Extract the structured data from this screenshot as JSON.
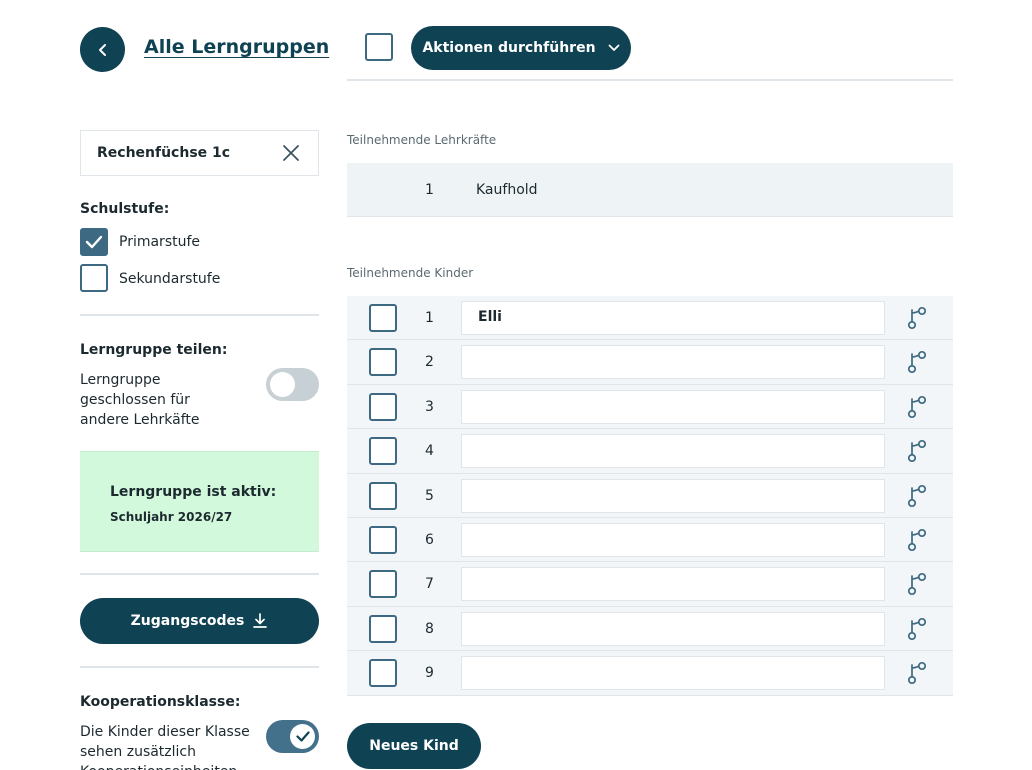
{
  "header": {
    "back_label": "Alle Lerngruppen",
    "actions_label": "Aktionen durchführen"
  },
  "group": {
    "name": "Rechenfüchse 1c"
  },
  "schulstufe": {
    "label": "Schulstufe:",
    "options": [
      {
        "label": "Primarstufe",
        "checked": true
      },
      {
        "label": "Sekundarstufe",
        "checked": false
      }
    ]
  },
  "sharing": {
    "label": "Lerngruppe teilen:",
    "description": "Lerngruppe geschlossen für andere Lehrkäfte",
    "enabled": false
  },
  "status": {
    "title": "Lerngruppe ist aktiv:",
    "year": "Schuljahr 2026/27"
  },
  "access_codes": {
    "label": "Zugangscodes"
  },
  "cooperation": {
    "label": "Kooperationsklasse:",
    "description": "Die Kinder dieser Klasse sehen zusätzlich Kooperationseinheiten",
    "enabled": true
  },
  "teachers": {
    "label": "Teilnehmende Lehrkräfte",
    "rows": [
      {
        "num": "1",
        "name": "Kaufhold"
      }
    ]
  },
  "kids": {
    "label": "Teilnehmende Kinder",
    "rows": [
      {
        "num": "1",
        "name": "Elli"
      },
      {
        "num": "2",
        "name": ""
      },
      {
        "num": "3",
        "name": ""
      },
      {
        "num": "4",
        "name": ""
      },
      {
        "num": "5",
        "name": ""
      },
      {
        "num": "6",
        "name": ""
      },
      {
        "num": "7",
        "name": ""
      },
      {
        "num": "8",
        "name": ""
      },
      {
        "num": "9",
        "name": ""
      }
    ],
    "new_label": "Neues Kind"
  },
  "colors": {
    "primary": "#0f4253",
    "checkbox": "#3d6a82",
    "active_bg": "#d3f9dc",
    "row_bg": "#f3f6f8"
  },
  "icons": [
    "chevron-left-icon",
    "close-icon",
    "check-icon",
    "chevron-down-icon",
    "download-icon",
    "branch-icon"
  ]
}
